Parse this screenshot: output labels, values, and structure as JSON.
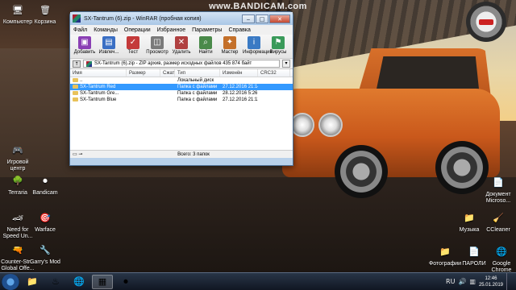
{
  "watermark": "www.BANDICAM.com",
  "desktop": {
    "left_icons": [
      {
        "label": "Компьютер",
        "icon": "computer-icon",
        "glyph": "🖥"
      },
      {
        "label": "Корзина",
        "icon": "recycle-bin-icon",
        "glyph": "🗑"
      },
      {
        "label": "Игровой центр",
        "icon": "game-center-icon",
        "glyph": "🎮"
      },
      {
        "label": "Terraria",
        "icon": "terraria-icon",
        "glyph": "🌳"
      },
      {
        "label": "Bandicam",
        "icon": "bandicam-icon",
        "glyph": "⏺"
      },
      {
        "label": "Need for Speed Un...",
        "icon": "nfs-icon",
        "glyph": "🏎"
      },
      {
        "label": "Warface",
        "icon": "warface-icon",
        "glyph": "🎯"
      },
      {
        "label": "Counter-Str... Global Offe...",
        "icon": "csgo-icon",
        "glyph": "🔫"
      },
      {
        "label": "Garry's Mod",
        "icon": "garrys-mod-icon",
        "glyph": "🔧"
      }
    ],
    "right_icons": [
      {
        "label": "Документ Microso...",
        "icon": "word-document-icon",
        "glyph": "📄"
      },
      {
        "label": "Музыка",
        "icon": "music-folder-icon",
        "glyph": "📁"
      },
      {
        "label": "CCleaner",
        "icon": "ccleaner-icon",
        "glyph": "🧹"
      },
      {
        "label": "Фотографии",
        "icon": "photos-folder-icon",
        "glyph": "📁"
      },
      {
        "label": "ПАРОЛИ",
        "icon": "text-file-icon",
        "glyph": "📄"
      },
      {
        "label": "Google Chrome",
        "icon": "chrome-icon",
        "glyph": "🌐"
      }
    ]
  },
  "window": {
    "title": "SX-Tantrum (6).zip - WinRAR (пробная копия)",
    "menu": [
      "Файл",
      "Команды",
      "Операции",
      "Избранное",
      "Параметры",
      "Справка"
    ],
    "toolbar": [
      {
        "label": "Добавить",
        "icon": "add-icon",
        "color": "#8a3fb4",
        "glyph": "▣"
      },
      {
        "label": "Извлеч...",
        "icon": "extract-icon",
        "color": "#3a6fc4",
        "glyph": "▤"
      },
      {
        "label": "Тест",
        "icon": "test-icon",
        "color": "#c43a3a",
        "glyph": "✓"
      },
      {
        "label": "Просмотр",
        "icon": "view-icon",
        "color": "#7a7a7a",
        "glyph": "◫"
      },
      {
        "label": "Удалить",
        "icon": "delete-icon",
        "color": "#b04040",
        "glyph": "✕"
      },
      {
        "label": "Найти",
        "icon": "find-icon",
        "color": "#4a8a4a",
        "glyph": "⌕"
      },
      {
        "label": "Мастер",
        "icon": "wizard-icon",
        "color": "#c4702a",
        "glyph": "✦"
      },
      {
        "label": "Информация",
        "icon": "info-icon",
        "color": "#3a7ac4",
        "glyph": "i"
      },
      {
        "label": "Вирусы",
        "icon": "virus-scan-icon",
        "color": "#3a9a5a",
        "glyph": "⚑"
      }
    ],
    "address": "SX-Tantrum (6).zip - ZIP архив, размер исходных файлов 435 874 байт",
    "columns": [
      "Имя",
      "Размер",
      "Сжат",
      "Тип",
      "Изменён",
      "CRC32"
    ],
    "rows": [
      {
        "name": "..",
        "size": "",
        "packed": "",
        "type": "Локальный диск",
        "modified": "",
        "crc": "",
        "selected": false
      },
      {
        "name": "SX-Tantrum Red",
        "size": "",
        "packed": "",
        "type": "Папка с файлами",
        "modified": "27.12.2016 21:14",
        "crc": "",
        "selected": true
      },
      {
        "name": "SX-Tantrum Gre...",
        "size": "",
        "packed": "",
        "type": "Папка с файлами",
        "modified": "28.12.2016 5:26",
        "crc": "",
        "selected": false
      },
      {
        "name": "SX-Tantrum Blue",
        "size": "",
        "packed": "",
        "type": "Папка с файлами",
        "modified": "27.12.2016 21:13",
        "crc": "",
        "selected": false
      }
    ],
    "status": "Всего: 3 папок"
  },
  "taskbar": {
    "apps": [
      {
        "icon": "explorer-icon",
        "glyph": "📁",
        "active": false
      },
      {
        "icon": "steam-icon",
        "glyph": "♨",
        "active": false
      },
      {
        "icon": "chrome-icon",
        "glyph": "🌐",
        "active": false
      },
      {
        "icon": "winrar-icon",
        "glyph": "▦",
        "active": true
      },
      {
        "icon": "bandicam-icon",
        "glyph": "⏺",
        "active": false
      }
    ],
    "language": "RU",
    "time": "12:46",
    "date": "25.01.2019"
  }
}
